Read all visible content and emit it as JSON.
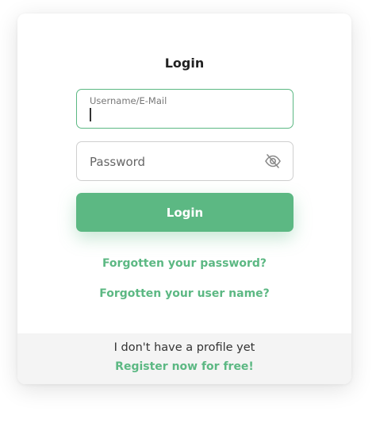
{
  "login": {
    "title": "Login",
    "username_label": "Username/E-Mail",
    "username_value": "",
    "password_placeholder": "Password",
    "password_value": "",
    "show_password_icon": "eye-slash-icon",
    "submit_label": "Login",
    "forgot_password": "Forgotten your password?",
    "forgot_username": "Forgotten your user name?"
  },
  "footer": {
    "no_profile": "I don't have a profile yet",
    "register": "Register now for free!"
  },
  "colors": {
    "accent": "#5cb883",
    "footer_bg": "#f4f4f4",
    "text": "#333333"
  }
}
